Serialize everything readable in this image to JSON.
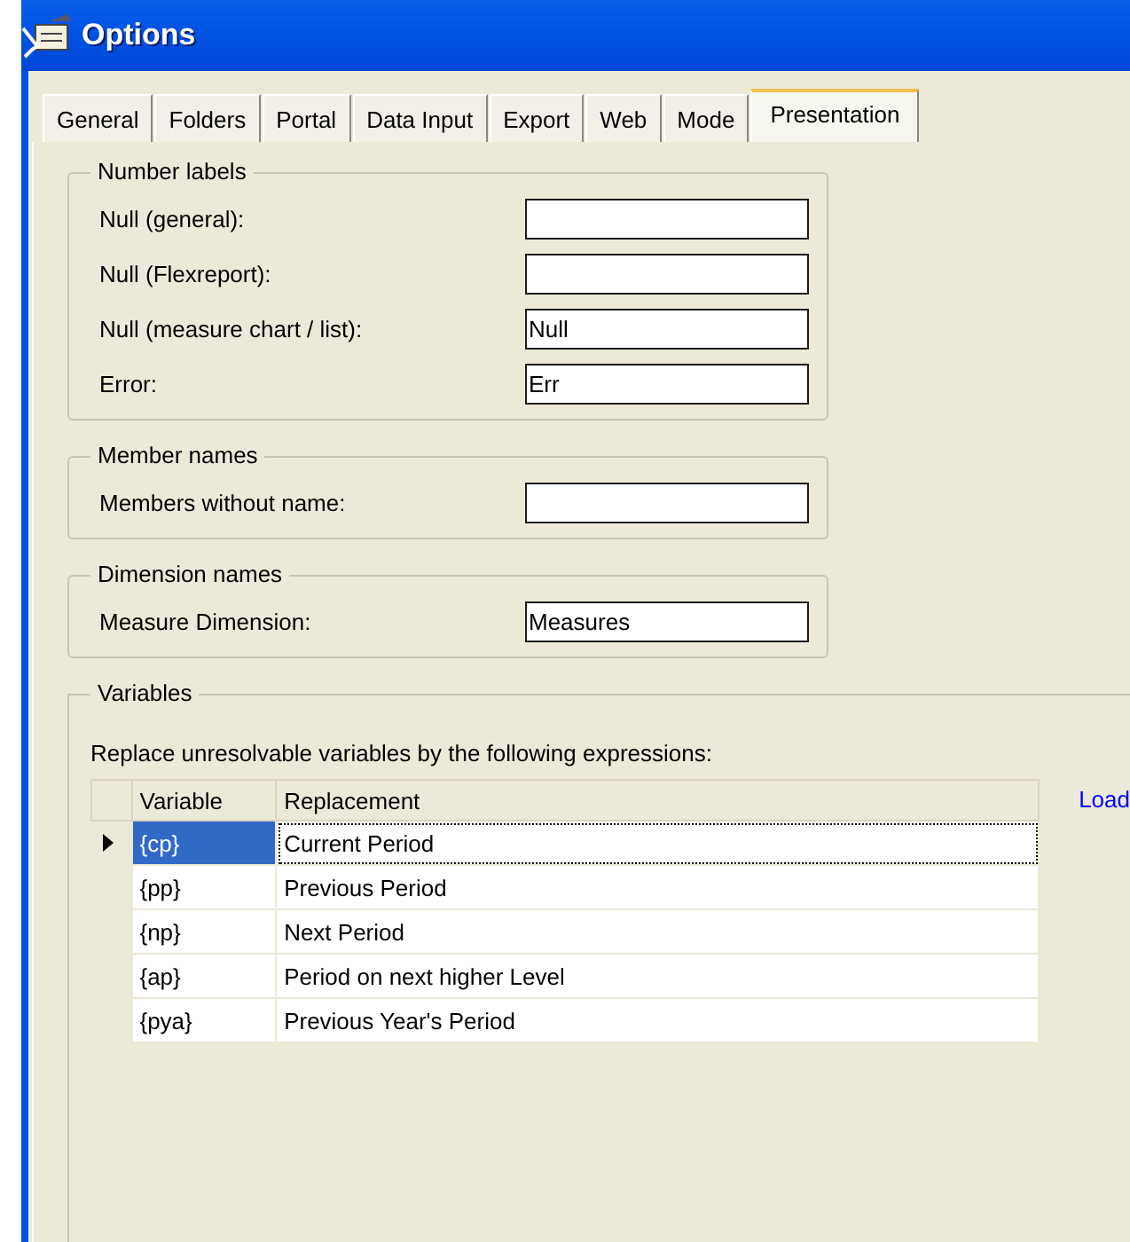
{
  "window": {
    "title": "Options"
  },
  "tabs": [
    {
      "label": "General",
      "selected": false
    },
    {
      "label": "Folders",
      "selected": false
    },
    {
      "label": "Portal",
      "selected": false
    },
    {
      "label": "Data Input",
      "selected": false
    },
    {
      "label": "Export",
      "selected": false
    },
    {
      "label": "Web",
      "selected": false
    },
    {
      "label": "Mode",
      "selected": false
    },
    {
      "label": "Presentation",
      "selected": true
    }
  ],
  "groups": [
    {
      "title": "Number labels",
      "fields": [
        {
          "label": "Null (general):"
        },
        {
          "label": "Null (Flexreport):"
        },
        {
          "label": "Null (measure chart / list):",
          "value": "Null"
        },
        {
          "label": "Error:",
          "value": "Err"
        }
      ]
    },
    {
      "title": "Member names",
      "fields": [
        {
          "label": "Members without name:"
        }
      ]
    },
    {
      "title": "Dimension names",
      "fields": [
        {
          "label": "Measure Dimension:",
          "value": "Measures"
        }
      ]
    }
  ],
  "variables": {
    "title": "Variables",
    "description": "Replace unresolvable variables by the following expressions:",
    "load_link": "Load",
    "table": {
      "columns": [
        "Variable",
        "Replacement"
      ],
      "rows": [
        {
          "variable": "{cp}",
          "replacement": "Current Period",
          "selected": true
        },
        {
          "variable": "{pp}",
          "replacement": "Previous Period",
          "selected": false
        },
        {
          "variable": "{np}",
          "replacement": "Next Period",
          "selected": false
        },
        {
          "variable": "{ap}",
          "replacement": "Period on next higher Level",
          "selected": false
        },
        {
          "variable": "{pya}",
          "replacement": "Previous Year's Period",
          "selected": false
        }
      ]
    }
  }
}
